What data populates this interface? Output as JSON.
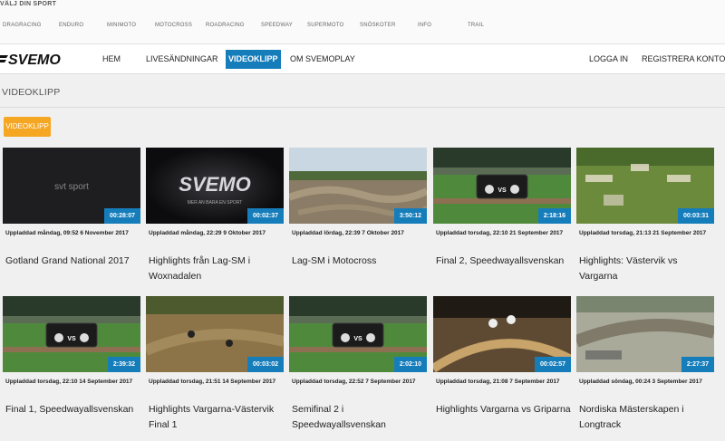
{
  "sports": {
    "title": "VÄLJ DIN SPORT",
    "items": [
      "DRAGRACING",
      "ENDURO",
      "MINIMOTO",
      "MOTOCROSS",
      "ROADRACING",
      "SPEEDWAY",
      "SUPERMOTO",
      "SNÖSKOTER",
      "INFO",
      "TRAIL"
    ]
  },
  "nav": {
    "brand": "SVEMO",
    "items": [
      "HEM",
      "LIVESÄNDNINGAR",
      "VIDEOKLIPP",
      "OM SVEMOPLAY"
    ],
    "active_index": 2,
    "right": [
      "LOGGA IN",
      "REGISTRERA KONTO"
    ]
  },
  "page": {
    "title": "VIDEOKLIPP",
    "filter_chip": "VIDEOKLIPP"
  },
  "videos": [
    {
      "duration": "00:28:07",
      "uploaded": "Uppladdad måndag, 09:52 6 November 2017",
      "title": "Gotland Grand National 2017",
      "thumb": "svt-logo",
      "thumb_text": "svt sport"
    },
    {
      "duration": "00:02:37",
      "uploaded": "Uppladdad måndag, 22:29 9 Oktober 2017",
      "title": "Highlights från Lag-SM i Woxnadalen",
      "thumb": "svemo-logo",
      "thumb_text": "SVEMO",
      "thumb_sub": "MER AN BARA EN SPORT"
    },
    {
      "duration": "3:50:12",
      "uploaded": "Uppladdad lördag, 22:39 7 Oktober 2017",
      "title": "Lag-SM i Motocross",
      "thumb": "motocross"
    },
    {
      "duration": "2:18:16",
      "uploaded": "Uppladdad torsdag, 22:10 21 September 2017",
      "title": "Final 2, Speedwayallsvenskan",
      "thumb": "speedway-vs",
      "thumb_text": "VS"
    },
    {
      "duration": "00:03:31",
      "uploaded": "Uppladdad torsdag, 21:13 21 September 2017",
      "title": "Highlights: Västervik vs Vargarna",
      "thumb": "speedway-blur"
    },
    {
      "duration": "2:39:32",
      "uploaded": "Uppladdad torsdag, 22:10 14 September 2017",
      "title": "Final 1, Speedwayallsvenskan",
      "thumb": "speedway-vs",
      "thumb_text": "VS"
    },
    {
      "duration": "00:03:02",
      "uploaded": "Uppladdad torsdag, 21:51 14 September 2017",
      "title": "Highlights Vargarna-Västervik Final 1",
      "thumb": "speedway-crash"
    },
    {
      "duration": "2:02:10",
      "uploaded": "Uppladdad torsdag, 22:52 7 September 2017",
      "title": "Semifinal 2 i Speedwayallsvenskan",
      "thumb": "speedway-vs",
      "thumb_text": "VS"
    },
    {
      "duration": "00:02:57",
      "uploaded": "Uppladdad torsdag, 21:08 7 September 2017",
      "title": "Highlights Vargarna vs Griparna",
      "thumb": "speedway-night"
    },
    {
      "duration": "2:27:37",
      "uploaded": "Uppladdad söndag, 00:24 3 September 2017",
      "title": "Nordiska Mästerskapen i Longtrack",
      "thumb": "longtrack"
    }
  ],
  "colors": {
    "accent": "#167dbb",
    "chip": "#f5a623",
    "background": "#f0f0f0"
  }
}
